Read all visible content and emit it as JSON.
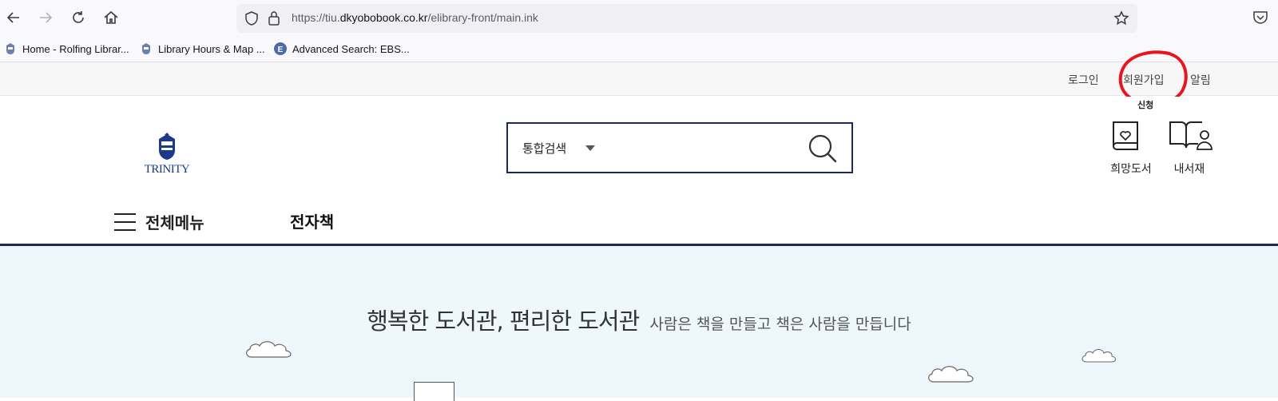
{
  "browser": {
    "url_prefix": "https://tiu.",
    "url_domain": "dkyobobook.co.kr",
    "url_path": "/elibrary-front/main.ink",
    "bookmarks": [
      {
        "label": "Home - Rolfing Librar..."
      },
      {
        "label": "Library Hours & Map ..."
      },
      {
        "label": "Advanced Search: EBS..."
      }
    ]
  },
  "util_nav": {
    "login": "로그인",
    "signup": "회원가입",
    "notifications": "알림"
  },
  "logo": {
    "text": "TRINITY"
  },
  "search": {
    "scope": "통합검색"
  },
  "quick_links": [
    {
      "label": "희망도서",
      "badge": "신청"
    },
    {
      "label": "내서재"
    }
  ],
  "nav": {
    "menu_label": "전체메뉴",
    "ebook_label": "전자책"
  },
  "hero": {
    "title": "행복한 도서관, 편리한 도서관",
    "subtitle": "사람은 책을 만들고 책은 사람을 만듭니다"
  }
}
